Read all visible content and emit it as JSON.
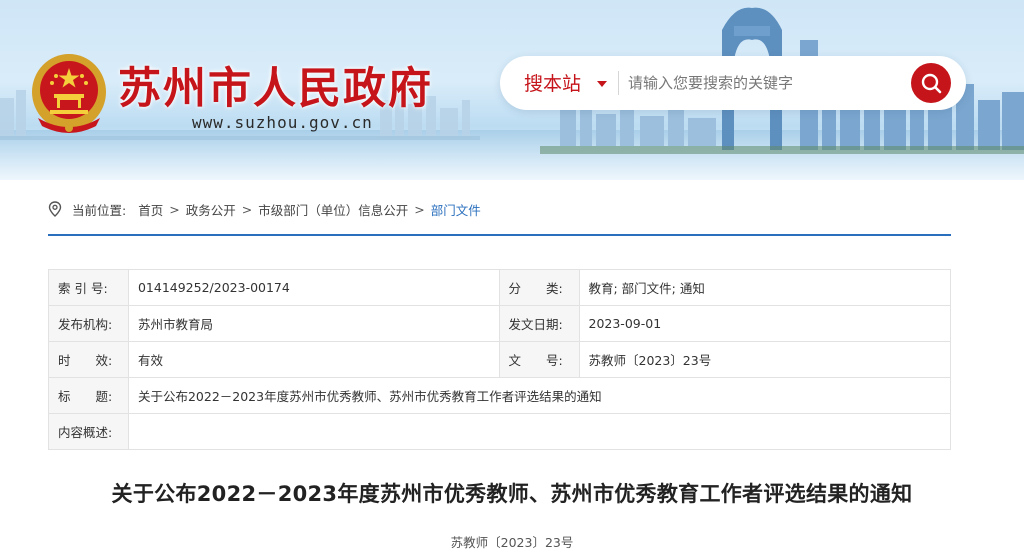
{
  "header": {
    "site_title": "苏州市人民政府",
    "site_url": "www.suzhou.gov.cn",
    "emblem_icon": "national-emblem-icon",
    "search": {
      "scope_label": "搜本站",
      "placeholder": "请输入您要搜索的关键字",
      "button_icon": "search-icon"
    }
  },
  "breadcrumb": {
    "prefix": "当前位置:",
    "items": [
      "首页",
      "政务公开",
      "市级部门（单位）信息公开",
      "部门文件"
    ],
    "separator": ">"
  },
  "info": {
    "rows": [
      {
        "label": "索 引 号:",
        "value": "014149252/2023-00174",
        "label2": "分　　类:",
        "value2": "教育;  部门文件;  通知"
      },
      {
        "label": "发布机构:",
        "value": "苏州市教育局",
        "label2": "发文日期:",
        "value2": "2023-09-01"
      },
      {
        "label": "时　　效:",
        "value": "有效",
        "label2": "文　　号:",
        "value2": "苏教师〔2023〕23号"
      }
    ],
    "title_label": "标　　题:",
    "title_value": "关于公布2022－2023年度苏州市优秀教师、苏州市优秀教育工作者评选结果的通知",
    "summary_label": "内容概述:",
    "summary_value": ""
  },
  "article": {
    "title": "关于公布2022－2023年度苏州市优秀教师、苏州市优秀教育工作者评选结果的通知",
    "doc_number": "苏教师〔2023〕23号"
  },
  "colors": {
    "brand_red": "#c5151b",
    "link_blue": "#2a6fbd"
  }
}
